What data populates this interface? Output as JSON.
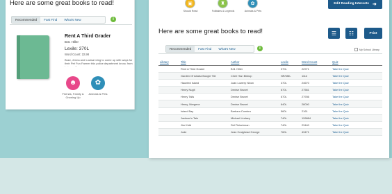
{
  "colors": {
    "background": "#9cd0d2",
    "primary_button": "#1d5a8a",
    "link": "#1a5f93",
    "info": "#6ebb3c",
    "book_cover": "#6cb993"
  },
  "left_panel": {
    "heading": "Here are some great books to read!",
    "tabs": [
      "Recommended",
      "Fast Find",
      "What's New"
    ],
    "info_icon": "i",
    "book": {
      "title": "Rent A Third Grader",
      "author": "B.B. Hiller",
      "lexile": "Lexile: 370L",
      "word_count": "Word Count: 22,98",
      "description": "Brad, Jenna and Louisa bring to come up with ways for their Pet Fun Farmer this police department know, from being written a..."
    },
    "categories": [
      {
        "label": "Friends, Family & Growing Up",
        "icon": "person-icon",
        "color": "#e8488a"
      },
      {
        "label": "Animals & Pets",
        "icon": "paw-icon",
        "color": "#2f8fb8"
      }
    ]
  },
  "right_panel": {
    "top_categories": [
      {
        "label": "Should Read",
        "icon": "book-icon",
        "color": "#f2b51b"
      },
      {
        "label": "Folktales & Legends",
        "icon": "castle-icon",
        "color": "#8bc34a"
      },
      {
        "label": "Animals & Pets",
        "icon": "paw-icon",
        "color": "#2f8fb8"
      }
    ],
    "edit_button": "Edit Reading Interests",
    "edit_arrow": "➜",
    "heading": "Here are some great books to read!",
    "print_button": "Print",
    "tabs": [
      "Recommended",
      "Fast Find",
      "What's New"
    ],
    "info_icon": "i",
    "my_school_library": "My School Library",
    "table": {
      "headers": [
        "Library",
        "Title",
        "Author",
        "Lexile",
        "Word Count",
        "Quiz"
      ],
      "rows": [
        [
          "",
          "Rent A Third Grader",
          "B.B. Hiller",
          "370L",
          "22971",
          "Take the Quiz"
        ],
        [
          "",
          "Garden Of Ababa Boogie Tile",
          "Chee Han Bishop",
          "NR/NNL",
          "1114",
          "Take the Quiz"
        ],
        [
          "",
          "Haunted Island",
          "Joan Lowery Nixon",
          "470L",
          "24670",
          "Take the Quiz"
        ],
        [
          "",
          "Henry Nugit",
          "Denise Brunet",
          "670L",
          "27581",
          "Take the Quiz"
        ],
        [
          "",
          "Henry Tails",
          "Denise Brunet",
          "670L",
          "27936",
          "Take the Quiz"
        ],
        [
          "",
          "Henry, Mergene",
          "Denise Brunet",
          "640L",
          "28000",
          "Take the Quiz"
        ],
        [
          "",
          "Island Bay",
          "Barbara Cumbra",
          "560L",
          "2161",
          "Take the Quiz"
        ],
        [
          "",
          "Jackson's Tale",
          "Michael Lindsey",
          "740L",
          "126884",
          "Take the Quiz"
        ],
        [
          "",
          "Jim Kidd",
          "Sid Fleischman",
          "740L",
          "23440",
          "Take the Quiz"
        ],
        [
          "",
          "Jode",
          "Jean Craighead George",
          "760L",
          "43471",
          "Take the Quiz"
        ]
      ]
    }
  }
}
